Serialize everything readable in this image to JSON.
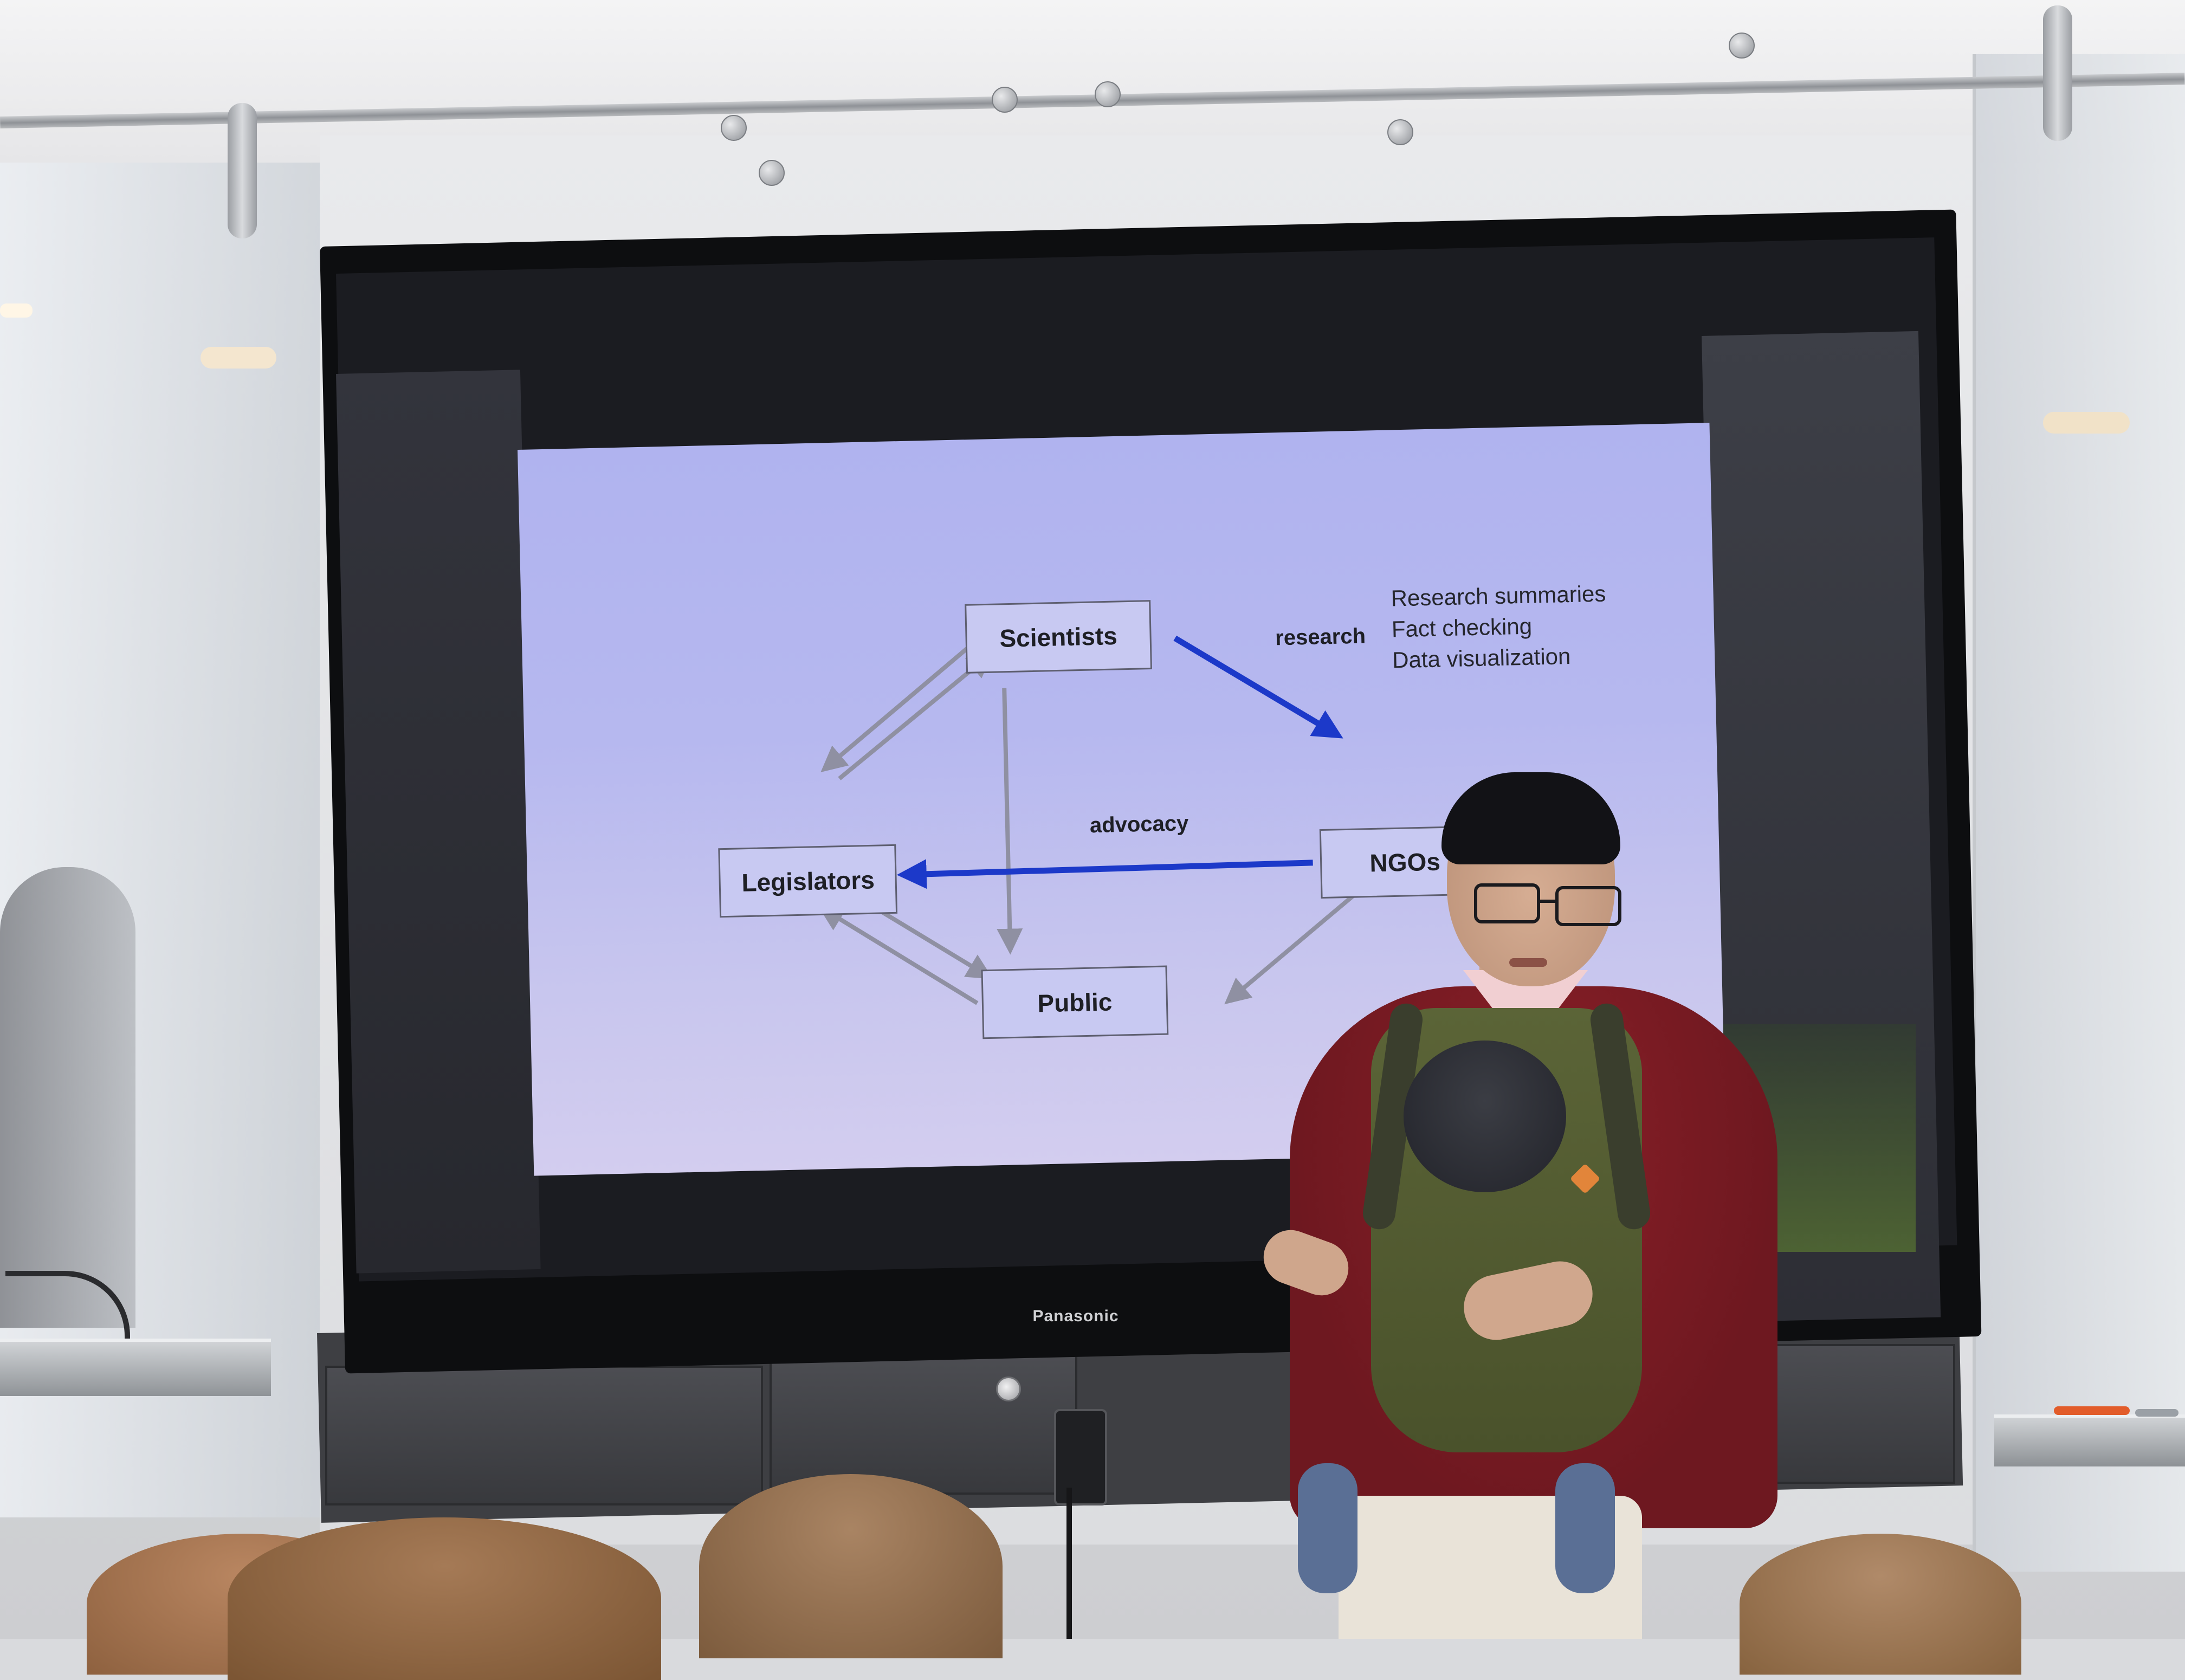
{
  "display": {
    "brand": "Panasonic"
  },
  "slide": {
    "nodes": {
      "scientists": "Scientists",
      "legislators": "Legislators",
      "ngos": "NGOs",
      "public": "Public"
    },
    "edge_labels": {
      "research": "research",
      "advocacy": "advocacy"
    },
    "notes": [
      "Research summaries",
      "Fact checking",
      "Data visualization"
    ],
    "colors": {
      "background": "#b3b5ef",
      "highlight_arrow": "#1c39c9",
      "gray_arrow": "#8f90a2"
    }
  }
}
